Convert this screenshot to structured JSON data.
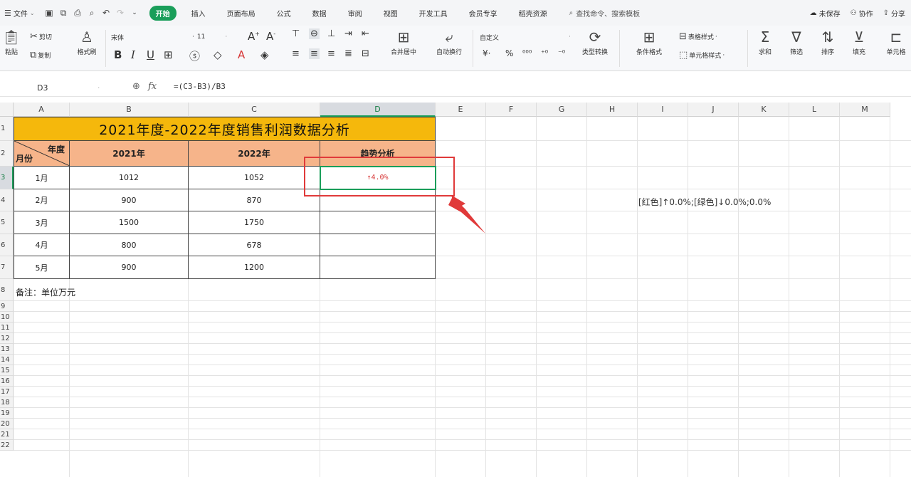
{
  "menubar": {
    "file_label": "文件",
    "tabs": [
      "开始",
      "插入",
      "页面布局",
      "公式",
      "数据",
      "审阅",
      "视图",
      "开发工具",
      "会员专享",
      "稻壳资源"
    ],
    "active_tab": "开始",
    "search_label": "查找命令、搜索模板",
    "right": {
      "unsaved": "未保存",
      "collab": "协作",
      "share": "分享"
    }
  },
  "ribbon": {
    "paste": "粘贴",
    "cut": "剪切",
    "copy": "复制",
    "format_painter": "格式刷",
    "font_name": "宋体",
    "font_size": "11",
    "merge": "合并居中",
    "wrap": "自动换行",
    "num_format": "自定义",
    "percent": "%",
    "type_convert": "类型转换",
    "cond_format": "条件格式",
    "table_style": "表格样式",
    "cell_style": "单元格样式",
    "sum": "求和",
    "filter": "筛选",
    "sort": "排序",
    "fill": "填充",
    "cells": "单元格"
  },
  "formula_bar": {
    "name_box": "D3",
    "fx": "fx",
    "formula": "=(C3-B3)/B3"
  },
  "sheet": {
    "columns": [
      "A",
      "B",
      "C",
      "D",
      "E",
      "F",
      "G",
      "H",
      "I",
      "J",
      "K",
      "L",
      "M"
    ],
    "selected_column": "D",
    "rows": [
      "1",
      "2",
      "3",
      "4",
      "5",
      "6",
      "7",
      "8",
      "9",
      "10",
      "11",
      "12",
      "13",
      "14",
      "15",
      "16",
      "17",
      "18",
      "19",
      "20",
      "21",
      "22"
    ],
    "selected_row": "3",
    "title": "2021年度-2022年度销售利润数据分析",
    "header": {
      "diag_top": "年度",
      "diag_bottom": "月份",
      "col_b": "2021年",
      "col_c": "2022年",
      "col_d": "趋势分析"
    },
    "data": [
      {
        "month": "1月",
        "y2021": "1012",
        "y2022": "1052",
        "trend": "↑4.0%"
      },
      {
        "month": "2月",
        "y2021": "900",
        "y2022": "870",
        "trend": ""
      },
      {
        "month": "3月",
        "y2021": "1500",
        "y2022": "1750",
        "trend": ""
      },
      {
        "month": "4月",
        "y2021": "800",
        "y2022": "678",
        "trend": ""
      },
      {
        "month": "5月",
        "y2021": "900",
        "y2022": "1200",
        "trend": ""
      }
    ],
    "note": "备注：单位万元",
    "format_code": "[红色]↑0.0%;[绿色]↓0.0%;0.0%",
    "colors": {
      "title_bg": "#f5b80c",
      "header_bg": "#f6b48a",
      "selection": "#1a9e5a",
      "annotation": "#e03a3a",
      "trend_text": "#d63333"
    }
  }
}
